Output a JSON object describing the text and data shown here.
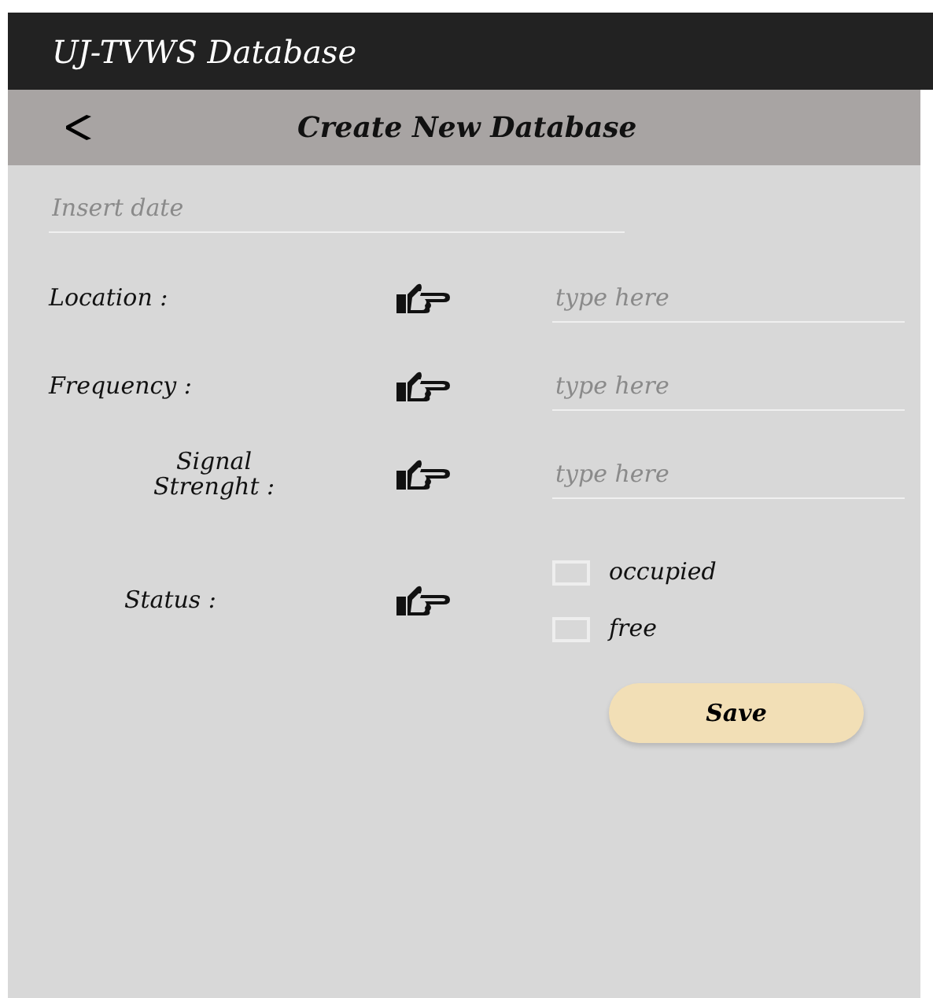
{
  "app_bar": {
    "title": "UJ-TVWS Database"
  },
  "header": {
    "title": "Create New Database"
  },
  "date_field": {
    "placeholder": "Insert date"
  },
  "fields": [
    {
      "label": "Location :",
      "placeholder": "type here"
    },
    {
      "label": "Frequency :",
      "placeholder": "type here"
    },
    {
      "label": "Signal Strenght :",
      "placeholder": "type here"
    }
  ],
  "status": {
    "label": "Status :",
    "options": [
      {
        "label": "occupied",
        "checked": false
      },
      {
        "label": "free",
        "checked": false
      }
    ]
  },
  "save_button": "Save"
}
